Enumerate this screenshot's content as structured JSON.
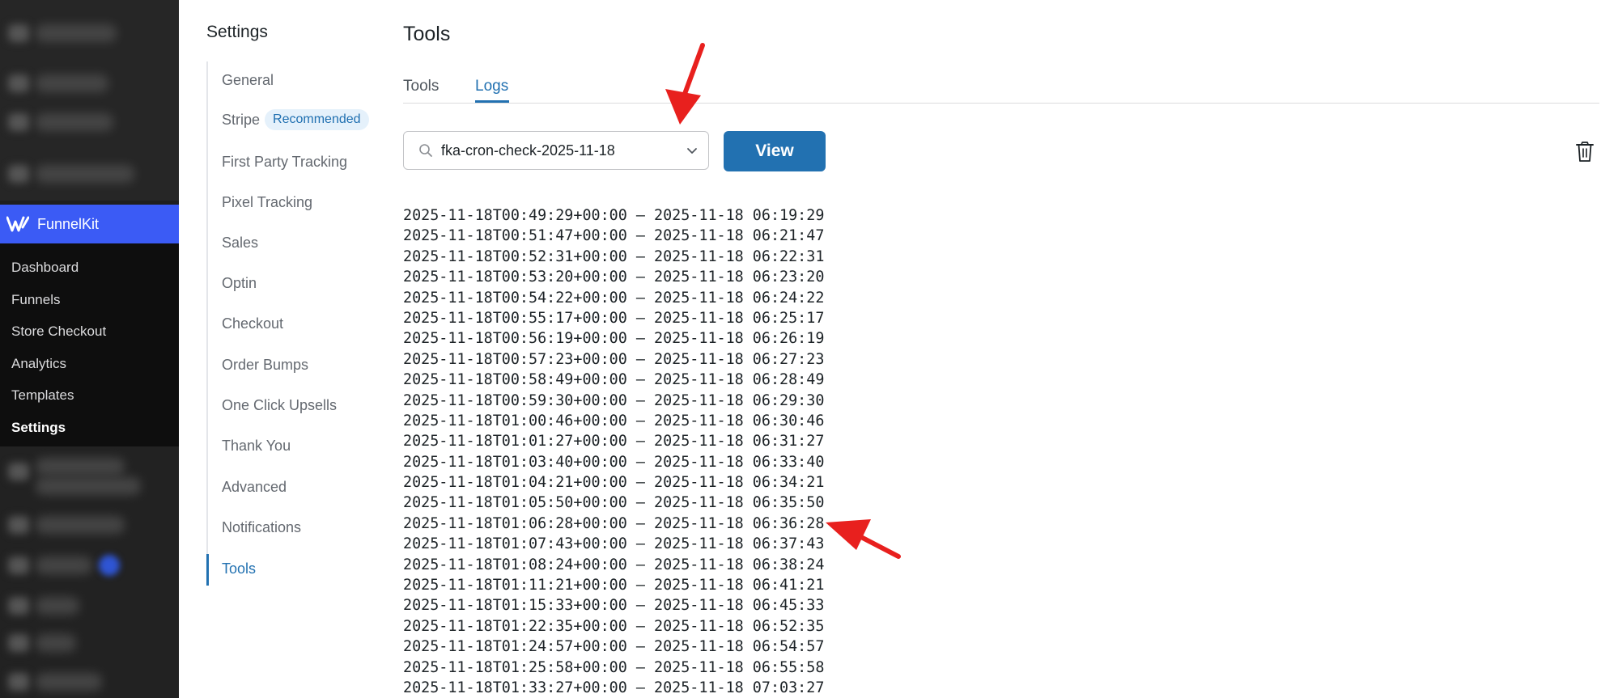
{
  "wp_sidebar": {
    "brand": {
      "label": "FunnelKit"
    },
    "submenu": [
      {
        "label": "Dashboard",
        "active": false
      },
      {
        "label": "Funnels",
        "active": false
      },
      {
        "label": "Store Checkout",
        "active": false
      },
      {
        "label": "Analytics",
        "active": false
      },
      {
        "label": "Templates",
        "active": false
      },
      {
        "label": "Settings",
        "active": true
      }
    ]
  },
  "settings_nav": {
    "heading": "Settings",
    "items": [
      {
        "label": "General"
      },
      {
        "label": "Stripe",
        "badge": "Recommended"
      },
      {
        "label": "First Party Tracking"
      },
      {
        "label": "Pixel Tracking"
      },
      {
        "label": "Sales"
      },
      {
        "label": "Optin"
      },
      {
        "label": "Checkout"
      },
      {
        "label": "Order Bumps"
      },
      {
        "label": "One Click Upsells"
      },
      {
        "label": "Thank You"
      },
      {
        "label": "Advanced"
      },
      {
        "label": "Notifications"
      },
      {
        "label": "Tools",
        "active": true
      }
    ]
  },
  "main": {
    "title": "Tools",
    "tabs": [
      {
        "label": "Tools",
        "active": false
      },
      {
        "label": "Logs",
        "active": true
      }
    ],
    "log_select": {
      "value": "fka-cron-check-2025-11-18"
    },
    "view_button": "View",
    "log_lines": [
      "2025-11-18T00:49:29+00:00 – 2025-11-18 06:19:29",
      "2025-11-18T00:51:47+00:00 – 2025-11-18 06:21:47",
      "2025-11-18T00:52:31+00:00 – 2025-11-18 06:22:31",
      "2025-11-18T00:53:20+00:00 – 2025-11-18 06:23:20",
      "2025-11-18T00:54:22+00:00 – 2025-11-18 06:24:22",
      "2025-11-18T00:55:17+00:00 – 2025-11-18 06:25:17",
      "2025-11-18T00:56:19+00:00 – 2025-11-18 06:26:19",
      "2025-11-18T00:57:23+00:00 – 2025-11-18 06:27:23",
      "2025-11-18T00:58:49+00:00 – 2025-11-18 06:28:49",
      "2025-11-18T00:59:30+00:00 – 2025-11-18 06:29:30",
      "2025-11-18T01:00:46+00:00 – 2025-11-18 06:30:46",
      "2025-11-18T01:01:27+00:00 – 2025-11-18 06:31:27",
      "2025-11-18T01:03:40+00:00 – 2025-11-18 06:33:40",
      "2025-11-18T01:04:21+00:00 – 2025-11-18 06:34:21",
      "2025-11-18T01:05:50+00:00 – 2025-11-18 06:35:50",
      "2025-11-18T01:06:28+00:00 – 2025-11-18 06:36:28",
      "2025-11-18T01:07:43+00:00 – 2025-11-18 06:37:43",
      "2025-11-18T01:08:24+00:00 – 2025-11-18 06:38:24",
      "2025-11-18T01:11:21+00:00 – 2025-11-18 06:41:21",
      "2025-11-18T01:15:33+00:00 – 2025-11-18 06:45:33",
      "2025-11-18T01:22:35+00:00 – 2025-11-18 06:52:35",
      "2025-11-18T01:24:57+00:00 – 2025-11-18 06:54:57",
      "2025-11-18T01:25:58+00:00 – 2025-11-18 06:55:58",
      "2025-11-18T01:33:27+00:00 – 2025-11-18 07:03:27"
    ]
  },
  "colors": {
    "accent": "#2271b1",
    "brand": "#3b5bf5",
    "annotation": "#e8201e"
  },
  "icons": [
    "funnelkit-logo-icon",
    "search-icon",
    "chevron-down-icon",
    "trash-icon",
    "annotation-arrow-icon"
  ]
}
